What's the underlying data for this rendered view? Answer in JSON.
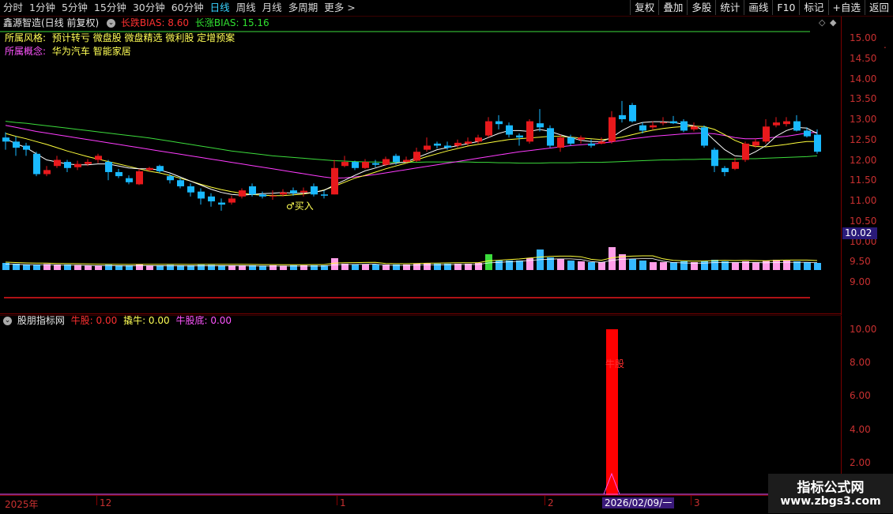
{
  "toolbar": {
    "timeframes": [
      "分时",
      "1分钟",
      "5分钟",
      "15分钟",
      "30分钟",
      "60分钟",
      "日线",
      "周线",
      "月线",
      "多周期",
      "更多"
    ],
    "active_timeframe": "日线",
    "more_arrow": ">",
    "buttons": [
      "复权",
      "叠加",
      "多股",
      "统计",
      "画线",
      "F10",
      "标记",
      "+自选",
      "返回"
    ]
  },
  "header": {
    "stock_name": "鑫源智造(日线 前复权)",
    "bias_down_label": "长跌BIAS: 8.60",
    "bias_up_label": "长涨BIAS: 15.16"
  },
  "info": {
    "style_label": "所属风格:",
    "style_value": "预计转亏 微盘股 微盘精选 微利股 定增预案",
    "concept_label": "所属概念:",
    "concept_value": "华为汽车 智能家居"
  },
  "annotations": {
    "buy_label": "♂买入",
    "bull_label": "牛股"
  },
  "price_axis": {
    "ticks": [
      "15.00",
      "14.50",
      "14.00",
      "13.50",
      "13.00",
      "12.50",
      "12.00",
      "11.50",
      "11.00",
      "10.50",
      "10.00",
      "9.50",
      "9.00"
    ],
    "current_price": "10.02"
  },
  "indicator": {
    "name": "股朋指标网",
    "niu_label": "牛股: 0.00",
    "qiao_label": "撬牛: 0.00",
    "niudi_label": "牛股底: 0.00",
    "ticks": [
      "10.00",
      "8.00",
      "6.00",
      "4.00",
      "2.00"
    ]
  },
  "date_axis": {
    "labels": [
      "2025年",
      "12",
      "1",
      "2",
      "3"
    ],
    "highlight": "2026/02/09/一"
  },
  "watermark": {
    "line1": "指标公式网",
    "line2": "www.zbgs3.com"
  },
  "colors": {
    "up": "#e8191c",
    "down": "#19b9ff",
    "ma_white": "#ffffff",
    "ma_yellow": "#ffff3c",
    "ma_magenta": "#ff3cff",
    "ma_green": "#3cdc3c",
    "volume_pink": "#ff9ee8",
    "volume_blue": "#35b8ff"
  },
  "chart_data": {
    "type": "candlestick",
    "ylim": [
      9.0,
      15.0
    ],
    "candles": [
      [
        12.55,
        12.45,
        12.68,
        12.25
      ],
      [
        12.45,
        12.3,
        12.58,
        12.1
      ],
      [
        12.35,
        12.25,
        12.42,
        12.1
      ],
      [
        12.15,
        11.65,
        12.2,
        11.6
      ],
      [
        11.65,
        11.75,
        11.85,
        11.6
      ],
      [
        11.85,
        12.0,
        12.1,
        11.8
      ],
      [
        11.95,
        11.8,
        12.0,
        11.7
      ],
      [
        11.82,
        11.9,
        11.98,
        11.75
      ],
      [
        11.9,
        11.95,
        12.02,
        11.85
      ],
      [
        12.0,
        12.1,
        12.15,
        11.92
      ],
      [
        11.95,
        11.7,
        12.0,
        11.5
      ],
      [
        11.7,
        11.6,
        11.78,
        11.55
      ],
      [
        11.55,
        11.45,
        11.62,
        11.4
      ],
      [
        11.4,
        11.72,
        11.78,
        11.38
      ],
      [
        11.75,
        11.8,
        11.83,
        11.72
      ],
      [
        11.85,
        11.72,
        11.88,
        11.68
      ],
      [
        11.6,
        11.5,
        11.65,
        11.42
      ],
      [
        11.5,
        11.35,
        11.55,
        11.3
      ],
      [
        11.35,
        11.2,
        11.42,
        11.1
      ],
      [
        11.22,
        11.05,
        11.3,
        10.9
      ],
      [
        11.1,
        10.98,
        11.18,
        10.85
      ],
      [
        10.95,
        10.9,
        11.05,
        10.75
      ],
      [
        10.95,
        11.05,
        11.12,
        10.9
      ],
      [
        11.1,
        11.25,
        11.3,
        11.05
      ],
      [
        11.35,
        11.15,
        11.42,
        11.1
      ],
      [
        11.15,
        11.1,
        11.22,
        11.05
      ],
      [
        11.1,
        11.12,
        11.25,
        11.02
      ],
      [
        11.15,
        11.2,
        11.28,
        11.1
      ],
      [
        11.25,
        11.18,
        11.32,
        11.12
      ],
      [
        11.2,
        11.24,
        11.32,
        11.1
      ],
      [
        11.35,
        11.15,
        11.42,
        11.1
      ],
      [
        11.15,
        11.12,
        11.25,
        11.05
      ],
      [
        11.15,
        11.8,
        12.0,
        11.15
      ],
      [
        11.85,
        11.95,
        12.1,
        11.82
      ],
      [
        11.95,
        11.8,
        11.98,
        11.75
      ],
      [
        11.8,
        11.95,
        12.02,
        11.78
      ],
      [
        11.92,
        11.88,
        12.0,
        11.82
      ],
      [
        11.88,
        12.02,
        12.08,
        11.85
      ],
      [
        12.1,
        11.95,
        12.15,
        11.88
      ],
      [
        11.95,
        12.0,
        12.08,
        11.92
      ],
      [
        11.98,
        12.2,
        12.3,
        11.95
      ],
      [
        12.25,
        12.35,
        12.55,
        12.2
      ],
      [
        12.4,
        12.35,
        12.45,
        12.28
      ],
      [
        12.35,
        12.3,
        12.45,
        12.25
      ],
      [
        12.35,
        12.42,
        12.5,
        12.3
      ],
      [
        12.4,
        12.45,
        12.55,
        12.35
      ],
      [
        12.45,
        12.55,
        12.62,
        12.4
      ],
      [
        12.6,
        12.95,
        13.05,
        12.55
      ],
      [
        12.95,
        12.88,
        13.1,
        12.75
      ],
      [
        12.85,
        12.62,
        12.92,
        12.55
      ],
      [
        12.6,
        12.55,
        12.65,
        12.35
      ],
      [
        12.45,
        12.95,
        13.0,
        12.4
      ],
      [
        12.9,
        12.8,
        13.25,
        12.7
      ],
      [
        12.78,
        12.35,
        12.85,
        12.3
      ],
      [
        12.3,
        12.55,
        12.62,
        12.2
      ],
      [
        12.55,
        12.4,
        12.62,
        12.35
      ],
      [
        12.5,
        12.55,
        12.6,
        12.4
      ],
      [
        12.4,
        12.35,
        12.5,
        12.3
      ],
      [
        12.4,
        12.45,
        12.55,
        12.38
      ],
      [
        12.45,
        13.05,
        13.2,
        12.4
      ],
      [
        13.1,
        13.0,
        13.45,
        12.92
      ],
      [
        13.35,
        12.95,
        13.4,
        12.92
      ],
      [
        12.85,
        12.72,
        12.92,
        12.65
      ],
      [
        12.8,
        12.85,
        12.95,
        12.75
      ],
      [
        12.9,
        12.92,
        13.05,
        12.85
      ],
      [
        12.95,
        12.9,
        13.08,
        12.88
      ],
      [
        12.95,
        12.72,
        13.0,
        12.68
      ],
      [
        12.75,
        12.82,
        12.92,
        12.7
      ],
      [
        12.8,
        12.35,
        12.85,
        12.3
      ],
      [
        12.25,
        11.85,
        12.3,
        11.7
      ],
      [
        11.8,
        11.7,
        11.85,
        11.6
      ],
      [
        11.78,
        11.95,
        12.05,
        11.75
      ],
      [
        12.0,
        12.4,
        12.45,
        11.95
      ],
      [
        12.35,
        12.45,
        12.52,
        12.3
      ],
      [
        12.45,
        12.82,
        13.0,
        12.4
      ],
      [
        12.85,
        12.92,
        13.05,
        12.8
      ],
      [
        12.88,
        12.95,
        13.05,
        12.82
      ],
      [
        12.95,
        12.72,
        13.1,
        12.7
      ],
      [
        12.72,
        12.58,
        12.8,
        12.55
      ],
      [
        12.62,
        12.2,
        12.75,
        12.15
      ]
    ],
    "ma_short": [
      12.52,
      12.4,
      12.3,
      12.15,
      12.0,
      11.95,
      11.9,
      11.88,
      11.88,
      11.9,
      11.9,
      11.85,
      11.8,
      11.78,
      11.78,
      11.75,
      11.68,
      11.58,
      11.48,
      11.38,
      11.28,
      11.2,
      11.15,
      11.13,
      11.15,
      11.17,
      11.18,
      11.2,
      11.18,
      11.18,
      11.2,
      11.25,
      11.38,
      11.5,
      11.62,
      11.73,
      11.8,
      11.88,
      11.92,
      11.95,
      12.05,
      12.15,
      12.25,
      12.3,
      12.35,
      12.4,
      12.45,
      12.55,
      12.65,
      12.72,
      12.72,
      12.7,
      12.75,
      12.7,
      12.62,
      12.55,
      12.48,
      12.45,
      12.45,
      12.55,
      12.72,
      12.85,
      12.92,
      12.94,
      12.94,
      12.92,
      12.88,
      12.84,
      12.72,
      12.48,
      12.25,
      12.1,
      12.08,
      12.2,
      12.35,
      12.58,
      12.72,
      12.8,
      12.78,
      12.65
    ],
    "ma_mid": [
      12.65,
      12.58,
      12.52,
      12.45,
      12.38,
      12.3,
      12.22,
      12.15,
      12.08,
      12.02,
      11.96,
      11.9,
      11.84,
      11.78,
      11.72,
      11.68,
      11.62,
      11.55,
      11.48,
      11.4,
      11.33,
      11.27,
      11.22,
      11.18,
      11.15,
      11.13,
      11.12,
      11.12,
      11.14,
      11.16,
      11.2,
      11.26,
      11.35,
      11.45,
      11.55,
      11.62,
      11.7,
      11.78,
      11.85,
      11.92,
      12.0,
      12.08,
      12.15,
      12.22,
      12.28,
      12.34,
      12.38,
      12.42,
      12.46,
      12.5,
      12.52,
      12.54,
      12.56,
      12.58,
      12.58,
      12.56,
      12.54,
      12.52,
      12.5,
      12.52,
      12.56,
      12.62,
      12.68,
      12.73,
      12.77,
      12.8,
      12.82,
      12.83,
      12.82,
      12.75,
      12.62,
      12.48,
      12.38,
      12.33,
      12.32,
      12.35,
      12.38,
      12.42,
      12.45,
      12.45
    ],
    "ma_long": [
      12.85,
      12.8,
      12.75,
      12.7,
      12.66,
      12.62,
      12.58,
      12.54,
      12.5,
      12.46,
      12.42,
      12.38,
      12.34,
      12.3,
      12.26,
      12.22,
      12.18,
      12.14,
      12.1,
      12.06,
      12.02,
      11.98,
      11.94,
      11.9,
      11.86,
      11.82,
      11.78,
      11.74,
      11.7,
      11.66,
      11.62,
      11.58,
      11.55,
      11.56,
      11.58,
      11.61,
      11.64,
      11.68,
      11.72,
      11.76,
      11.8,
      11.84,
      11.88,
      11.92,
      11.96,
      12.0,
      12.04,
      12.08,
      12.12,
      12.16,
      12.2,
      12.23,
      12.26,
      12.29,
      12.32,
      12.35,
      12.37,
      12.39,
      12.41,
      12.44,
      12.48,
      12.52,
      12.55,
      12.58,
      12.6,
      12.62,
      12.64,
      12.65,
      12.66,
      12.64,
      12.6,
      12.55,
      12.52,
      12.52,
      12.54,
      12.56,
      12.58,
      12.62,
      12.66,
      12.68
    ],
    "ma_green": [
      12.95,
      12.92,
      12.9,
      12.87,
      12.84,
      12.81,
      12.78,
      12.75,
      12.72,
      12.69,
      12.66,
      12.63,
      12.6,
      12.57,
      12.54,
      12.5,
      12.46,
      12.42,
      12.38,
      12.34,
      12.3,
      12.26,
      12.22,
      12.19,
      12.16,
      12.13,
      12.1,
      12.08,
      12.06,
      12.04,
      12.02,
      12.0,
      11.98,
      11.97,
      11.96,
      11.95,
      11.95,
      11.94,
      11.94,
      11.94,
      11.94,
      11.95,
      11.95,
      11.95,
      11.95,
      11.95,
      11.94,
      11.94,
      11.93,
      11.93,
      11.92,
      11.92,
      11.92,
      11.93,
      11.93,
      11.93,
      11.94,
      11.94,
      11.94,
      11.95,
      11.96,
      11.97,
      11.98,
      11.99,
      12.0,
      12.0,
      12.01,
      12.01,
      12.02,
      12.02,
      12.02,
      12.02,
      12.03,
      12.03,
      12.04,
      12.05,
      12.06,
      12.07,
      12.08,
      12.1
    ],
    "volume": [
      0.45,
      0.4,
      0.35,
      0.35,
      0.38,
      0.35,
      0.35,
      0.33,
      0.3,
      0.3,
      0.33,
      0.3,
      0.3,
      0.35,
      0.3,
      0.3,
      0.32,
      0.3,
      0.3,
      0.33,
      0.32,
      0.3,
      0.3,
      0.3,
      0.3,
      0.28,
      0.3,
      0.28,
      0.3,
      0.3,
      0.3,
      0.3,
      0.75,
      0.4,
      0.35,
      0.35,
      0.35,
      0.35,
      0.35,
      0.35,
      0.4,
      0.45,
      0.4,
      0.4,
      0.4,
      0.4,
      0.45,
      1.0,
      0.6,
      0.6,
      0.6,
      0.75,
      1.3,
      0.8,
      0.7,
      0.6,
      0.55,
      0.5,
      0.5,
      1.45,
      1.0,
      0.7,
      0.6,
      0.5,
      0.5,
      0.5,
      0.55,
      0.5,
      0.55,
      0.65,
      0.55,
      0.5,
      0.55,
      0.5,
      0.6,
      0.65,
      0.6,
      0.55,
      0.5,
      0.45
    ],
    "volume_special": {
      "32": "#ff9ee8",
      "47": "#3cdc3c",
      "59": "#ff9ee8",
      "60": "#ff9ee8"
    },
    "bull_signal_index": 59,
    "bull_signal_value": 10.0,
    "indicator_ylim": [
      0,
      10.5
    ]
  }
}
